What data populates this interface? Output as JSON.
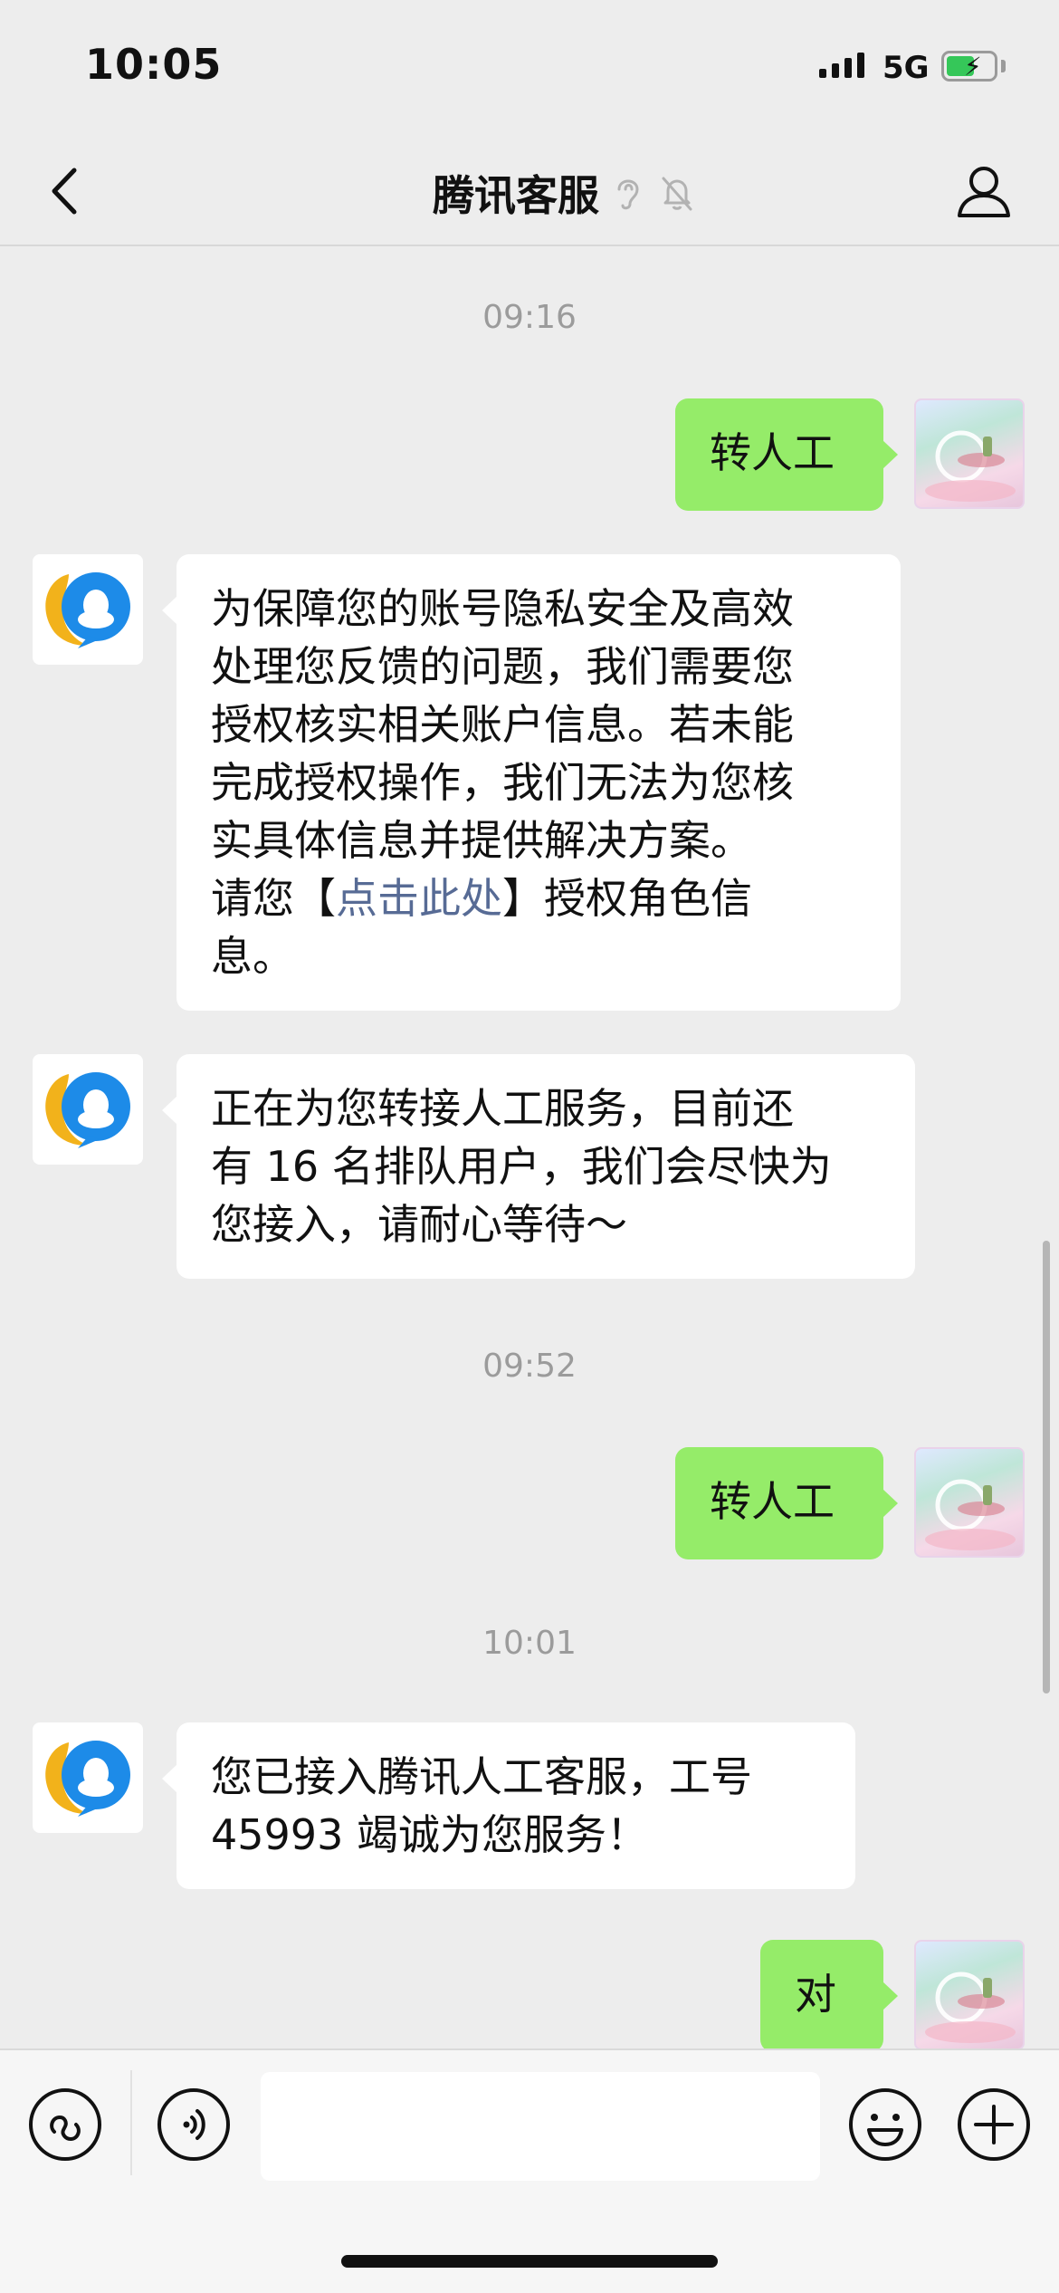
{
  "status_bar": {
    "time": "10:05",
    "network": "5G",
    "battery_charging": true
  },
  "nav": {
    "title": "腾讯客服",
    "back_icon": "chevron-left-icon",
    "earpiece_icon": "ear-icon",
    "mute_icon": "bell-muted-icon",
    "profile_icon": "person-icon"
  },
  "messages": [
    {
      "type": "time",
      "text": "09:16"
    },
    {
      "type": "sent",
      "text": "转人工"
    },
    {
      "type": "received",
      "lines": [
        "为保障您的账号隐私安全及高效",
        "处理您反馈的问题，我们需要您",
        "授权核实相关账户信息。若未能",
        "完成授权操作，我们无法为您核",
        "实具体信息并提供解决方案。"
      ],
      "line6_pre": "请您【",
      "link_text": "点击此处",
      "line6_post": "】授权角色信",
      "line7": "息。"
    },
    {
      "type": "received",
      "lines": [
        "正在为您转接人工服务，目前还",
        "有 16 名排队用户，我们会尽快为",
        "您接入，请耐心等待～"
      ]
    },
    {
      "type": "time",
      "text": "09:52"
    },
    {
      "type": "sent",
      "text": "转人工"
    },
    {
      "type": "time",
      "text": "10:01"
    },
    {
      "type": "received",
      "lines": [
        "您已接入腾讯人工客服，工号",
        "45993 竭诚为您服务！"
      ]
    },
    {
      "type": "sent",
      "text": "对"
    }
  ],
  "input_bar": {
    "mini_program_icon": "link-icon",
    "voice_icon": "voice-icon",
    "input_value": "",
    "emoji_icon": "emoji-icon",
    "plus_icon": "plus-icon"
  },
  "colors": {
    "sent_bubble": "#95ec69",
    "received_bubble": "#ffffff",
    "background": "#ededed",
    "link": "#576b95",
    "timestamp": "#9b9b9b"
  }
}
